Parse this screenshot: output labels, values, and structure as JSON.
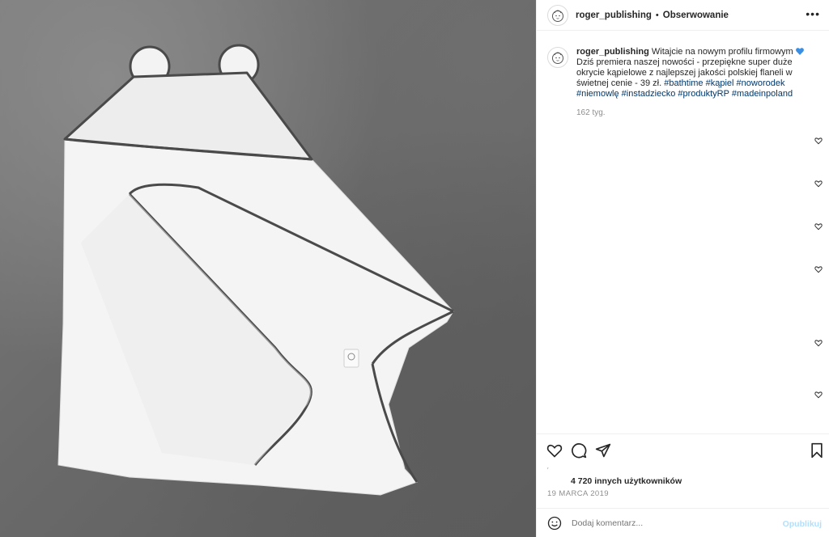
{
  "header": {
    "username": "roger_publishing",
    "separator": "•",
    "follow_label": "Obserwowanie",
    "more_icon": "more-horizontal-icon"
  },
  "caption": {
    "username": "roger_publishing",
    "intro": "Witajcie na nowym profilu firmowym",
    "emoji": "blue-heart",
    "body": "Dziś premiera naszej nowości - przepiękne super duże okrycie kąpielowe z najlepszej jakości polskiej flaneli w świetnej cenie - 39 zł.",
    "hashtags": [
      "#bathtime",
      "#kąpiel",
      "#noworodek",
      "#niemowlę",
      "#instadziecko",
      "#produktyRP",
      "#madeinpoland"
    ],
    "age": "162 tyg."
  },
  "actions": {
    "like_icon": "heart-icon",
    "comment_icon": "comment-icon",
    "share_icon": "send-icon",
    "save_icon": "bookmark-icon"
  },
  "likes_text": "4 720 innych użytkowników",
  "date_text": "19 MARCA 2019",
  "comment": {
    "placeholder": "Dodaj komentarz...",
    "post_label": "Opublikuj"
  },
  "colors": {
    "hashtag": "#00376b",
    "muted": "#8e8e8e",
    "post_disabled": "#b2dffc",
    "emoji_heart": "#3b8fe3"
  }
}
